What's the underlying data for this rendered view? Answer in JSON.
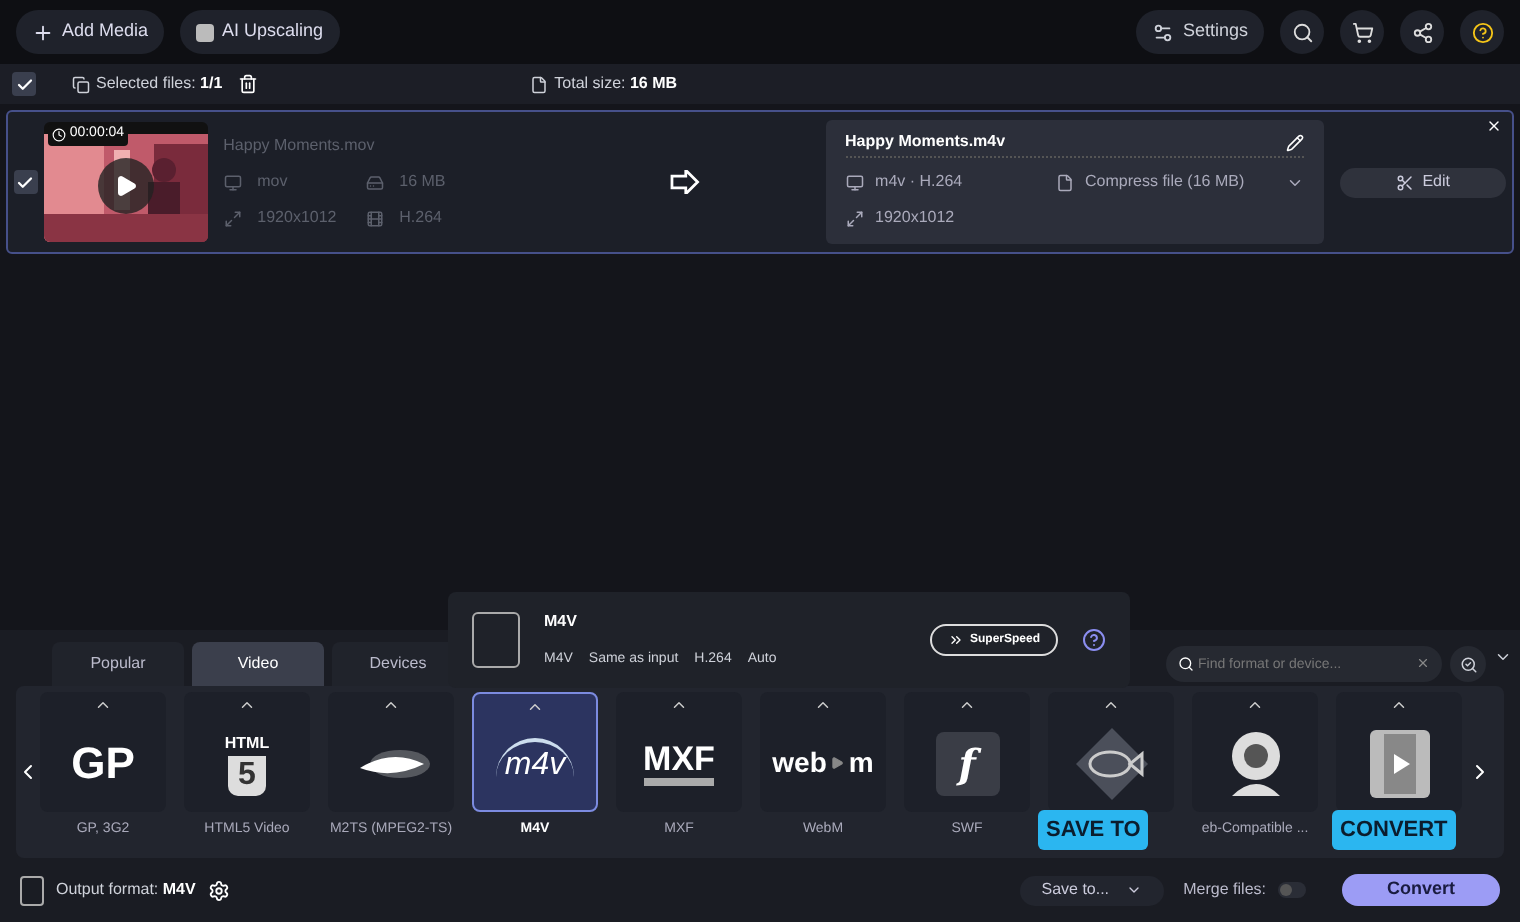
{
  "toolbar": {
    "left": [
      {
        "label": "Add Media",
        "kind": "plus"
      },
      {
        "label": "AI Upscaling",
        "kind": "ai"
      }
    ],
    "settings": "Settings"
  },
  "selection_bar": {
    "checked": true,
    "selected_label": "Selected files:",
    "selected_value": "1/1",
    "total_label": "Total size:",
    "total_value": "16 MB"
  },
  "file": {
    "checked": true,
    "duration": "00:00:04",
    "name": "Happy Moments.mov",
    "format": "mov",
    "size": "16 MB",
    "resolution": "1920x1012",
    "codec": "H.264",
    "output": {
      "name": "Happy Moments.m4v",
      "format": "m4v · H.264",
      "compress": "Compress file (16 MB)",
      "resolution": "1920x1012"
    },
    "edit": "Edit"
  },
  "format_popup": {
    "title": "M4V",
    "specs": [
      "M4V",
      "Same as input",
      "H.264",
      "Auto"
    ],
    "superspeed": "SuperSpeed"
  },
  "tabs": [
    {
      "label": "Popular",
      "selected": false
    },
    {
      "label": "Video",
      "selected": true
    },
    {
      "label": "Devices",
      "selected": false
    }
  ],
  "search": {
    "placeholder": "Find format or device..."
  },
  "formats": [
    {
      "kind": "gp",
      "logo": [
        "GP"
      ],
      "label": "GP, 3G2",
      "selected": false
    },
    {
      "kind": "html5",
      "logo": [
        "HTML",
        "5"
      ],
      "label": "HTML5 Video",
      "selected": false
    },
    {
      "kind": "bluray",
      "label": "M2TS (MPEG2-TS)",
      "selected": false
    },
    {
      "kind": "m4v",
      "logo": [
        "m4v"
      ],
      "label": "M4V",
      "selected": true
    },
    {
      "kind": "mxf",
      "logo": [
        "MXF"
      ],
      "label": "MXF",
      "selected": false
    },
    {
      "kind": "webm",
      "logo": [
        "web",
        "m"
      ],
      "label": "WebM",
      "selected": false
    },
    {
      "kind": "flash",
      "logo": [
        "f"
      ],
      "label": "SWF",
      "selected": false
    },
    {
      "kind": "fish",
      "selected": false
    },
    {
      "kind": "webcam",
      "label": "eb-Compatible ...",
      "selected": false
    },
    {
      "kind": "film",
      "selected": false
    }
  ],
  "bottom": {
    "output_label": "Output format:",
    "output_value": "M4V",
    "save_to": "Save to...",
    "merge_label": "Merge files:",
    "merge_on": false,
    "convert": "Convert"
  },
  "callouts": [
    {
      "kind": "save",
      "text": "SAVE TO"
    },
    {
      "kind": "convert",
      "text": "CONVERT"
    }
  ]
}
